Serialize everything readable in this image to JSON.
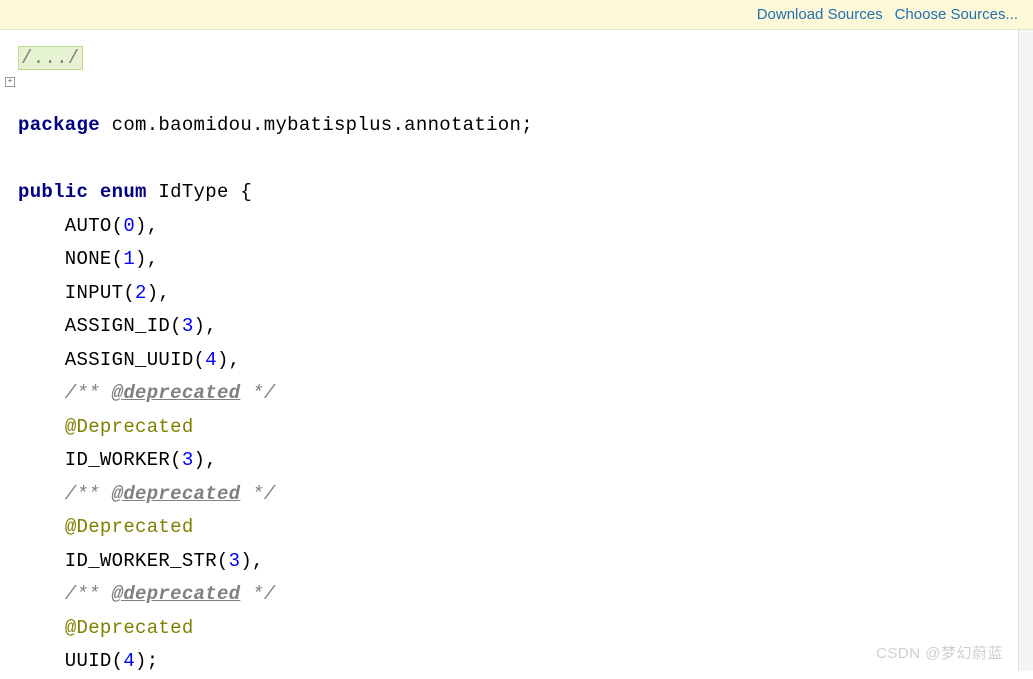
{
  "notification": {
    "download_sources": "Download Sources",
    "choose_sources": "Choose Sources..."
  },
  "code": {
    "folded_comment": "/.../",
    "kw_package": "package",
    "package_name": " com.baomidou.mybatisplus.annotation;",
    "kw_public": "public",
    "kw_enum": " enum",
    "class_name": " IdType {",
    "auto_name": "    AUTO(",
    "auto_val": "0",
    "auto_end": "),",
    "none_name": "    NONE(",
    "none_val": "1",
    "none_end": "),",
    "input_name": "    INPUT(",
    "input_val": "2",
    "input_end": "),",
    "assign_id_name": "    ASSIGN_ID(",
    "assign_id_val": "3",
    "assign_id_end": "),",
    "assign_uuid_name": "    ASSIGN_UUID(",
    "assign_uuid_val": "4",
    "assign_uuid_end": "),",
    "dep_comment_start": "    /** ",
    "dep_tag": "@deprecated",
    "dep_comment_end": " */",
    "dep_annotation_indent": "    ",
    "dep_annotation": "@Deprecated",
    "id_worker_name": "    ID_WORKER(",
    "id_worker_val": "3",
    "id_worker_end": "),",
    "id_worker_str_name": "    ID_WORKER_STR(",
    "id_worker_str_val": "3",
    "id_worker_str_end": "),",
    "uuid_name": "    UUID(",
    "uuid_val": "4",
    "uuid_end": ");"
  },
  "watermark": "CSDN @梦幻蔚蓝"
}
